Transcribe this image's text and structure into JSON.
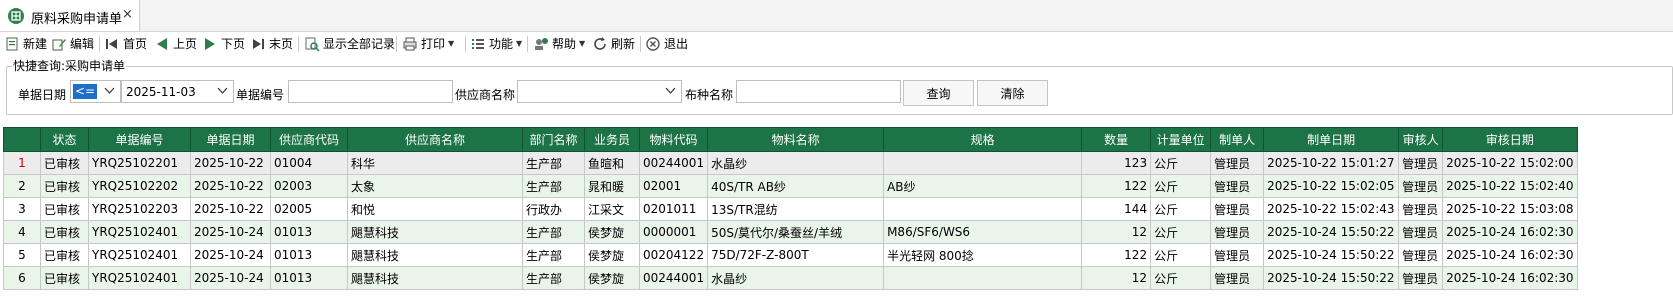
{
  "tab": {
    "title": "原料采购申请单",
    "icon": "grid-app-icon",
    "close": "×"
  },
  "toolbar": {
    "new": "新建",
    "edit": "编辑",
    "first": "首页",
    "prev": "上页",
    "next": "下页",
    "last": "末页",
    "show_all": "显示全部记录",
    "print": "打印",
    "function": "功能",
    "help": "帮助",
    "refresh": "刷新",
    "exit": "退出"
  },
  "quick_query": {
    "title": "快捷查询:采购申请单",
    "date_label": "单据日期",
    "date_operator": "<=",
    "date_value": "2025-11-03",
    "doc_no_label": "单据编号",
    "doc_no_value": "",
    "supplier_label": "供应商名称",
    "supplier_value": "",
    "cloth_label": "布种名称",
    "cloth_value": "",
    "query_button": "查询",
    "clear_button": "清除"
  },
  "grid": {
    "columns": [
      "",
      "状态",
      "单据编号",
      "单据日期",
      "供应商代码",
      "供应商名称",
      "部门名称",
      "业务员",
      "物料代码",
      "物料名称",
      "规格",
      "数量",
      "计量单位",
      "制单人",
      "制单日期",
      "审核人",
      "审核日期"
    ],
    "rows": [
      [
        "1",
        "已审核",
        "YRQ25102201",
        "2025-10-22",
        "01004",
        "科华",
        "生产部",
        "鱼暄和",
        "00244001",
        "水晶纱",
        "",
        "123",
        "公斤",
        "管理员",
        "2025-10-22 15:01:27",
        "管理员",
        "2025-10-22 15:02:00"
      ],
      [
        "2",
        "已审核",
        "YRQ25102202",
        "2025-10-22",
        "02003",
        "太象",
        "生产部",
        "晁和暖",
        "02001",
        "40S/TR AB纱",
        "AB纱",
        "122",
        "公斤",
        "管理员",
        "2025-10-22 15:02:05",
        "管理员",
        "2025-10-22 15:02:40"
      ],
      [
        "3",
        "已审核",
        "YRQ25102203",
        "2025-10-22",
        "02005",
        "和悦",
        "行政办",
        "江采文",
        "0201011",
        "13S/TR混纺",
        "",
        "144",
        "公斤",
        "管理员",
        "2025-10-22 15:02:43",
        "管理员",
        "2025-10-22 15:03:08"
      ],
      [
        "4",
        "已审核",
        "YRQ25102401",
        "2025-10-24",
        "01013",
        "飓慧科技",
        "生产部",
        "侯梦旋",
        "0000001",
        "50S/莫代尔/桑蚕丝/羊绒",
        "M86/SF6/WS6",
        "12",
        "公斤",
        "管理员",
        "2025-10-24 15:50:22",
        "管理员",
        "2025-10-24 16:02:30"
      ],
      [
        "5",
        "已审核",
        "YRQ25102401",
        "2025-10-24",
        "01013",
        "飓慧科技",
        "生产部",
        "侯梦旋",
        "00204122",
        "75D/72F-Z-800T",
        "半光轻网  800捻",
        "122",
        "公斤",
        "管理员",
        "2025-10-24 15:50:22",
        "管理员",
        "2025-10-24 16:02:30"
      ],
      [
        "6",
        "已审核",
        "YRQ25102401",
        "2025-10-24",
        "01013",
        "飓慧科技",
        "生产部",
        "侯梦旋",
        "00244001",
        "水晶纱",
        "",
        "12",
        "公斤",
        "管理员",
        "2025-10-24 15:50:22",
        "管理员",
        "2025-10-24 16:02:30"
      ]
    ]
  },
  "colors": {
    "header_bg": "#1c7346",
    "header_text": "#ffffff",
    "row_alt": "#eaf5ea",
    "selection": "#1f6fc7",
    "row_number_first": "#d10000"
  }
}
